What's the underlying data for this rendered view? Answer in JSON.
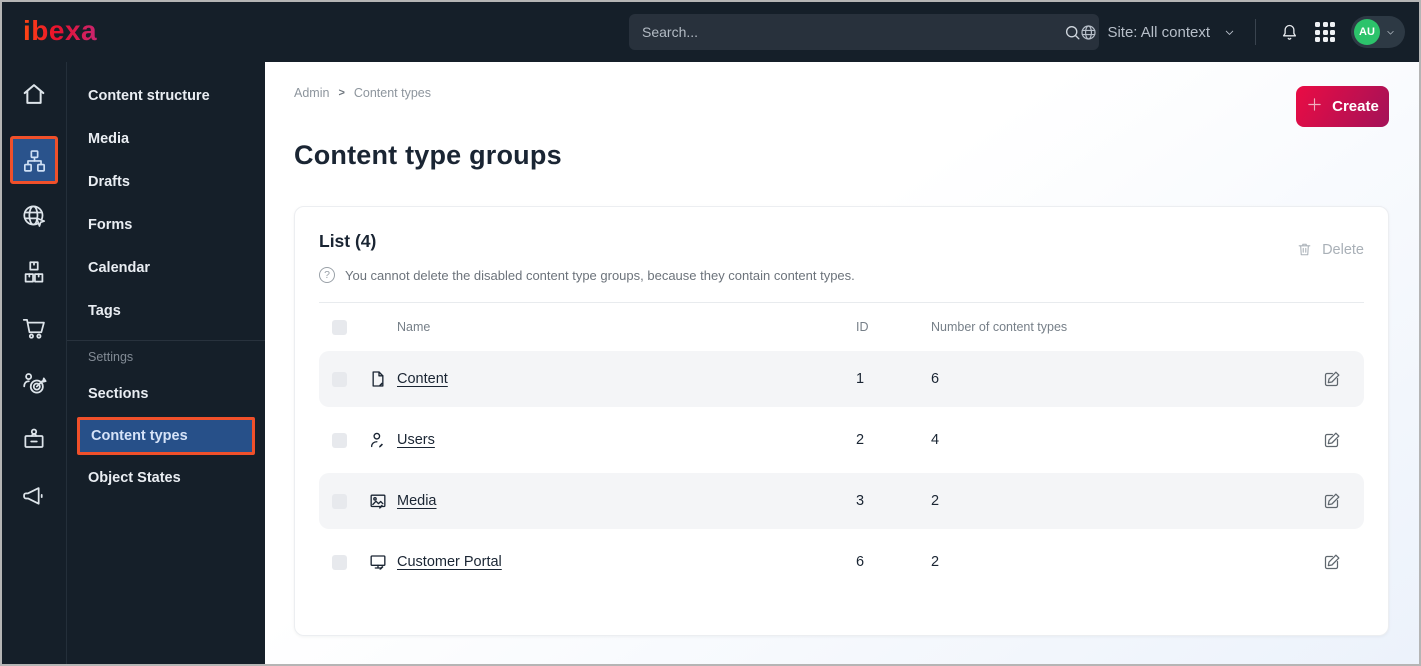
{
  "topbar": {
    "logo_text": "ibexa",
    "search": {
      "placeholder": "Search..."
    },
    "site_context_label": "Site: All context",
    "avatar_initials": "AU",
    "icons": [
      "search-icon",
      "globe-icon",
      "chevron-down-icon",
      "bell-icon",
      "app-grid-icon"
    ]
  },
  "nav_rail": {
    "icons": [
      "home-icon",
      "content-structure-icon",
      "site-globe-icon",
      "product-catalog-icon",
      "commerce-cart-icon",
      "personalization-icon",
      "admin-badge-icon",
      "campaign-megaphone-icon"
    ],
    "active_icon": "content-structure-icon"
  },
  "sidebar": {
    "items": [
      "Content structure",
      "Media",
      "Drafts",
      "Forms",
      "Calendar",
      "Tags"
    ],
    "settings_label": "Settings",
    "settings_items": [
      "Sections",
      "Content types",
      "Object States"
    ],
    "active_item": "Content types"
  },
  "breadcrumb": {
    "items": [
      "Admin",
      "Content types"
    ],
    "separator": ">"
  },
  "page": {
    "title": "Content type groups"
  },
  "actions": {
    "create_label": "Create",
    "delete_label": "Delete"
  },
  "list_card": {
    "title": "List (4)",
    "info_text": "You cannot delete the disabled content type groups, because they contain content types.",
    "headers": {
      "name": "Name",
      "id": "ID",
      "count": "Number of content types"
    },
    "rows": [
      {
        "name": "Content",
        "icon": "file-edit-icon",
        "id": "1",
        "count": "6"
      },
      {
        "name": "Users",
        "icon": "user-edit-icon",
        "id": "2",
        "count": "4"
      },
      {
        "name": "Media",
        "icon": "image-edit-icon",
        "id": "3",
        "count": "2"
      },
      {
        "name": "Customer Portal",
        "icon": "monitor-edit-icon",
        "id": "6",
        "count": "2"
      }
    ]
  },
  "colors": {
    "topbar_bg": "#151f29",
    "accent_orange": "#f0502a",
    "selected_blue": "#2a538c",
    "create_gradient": [
      "#ea0c44",
      "#a31258"
    ],
    "avatar_green": "#2cc36b",
    "zebra_row": "#f4f5f7"
  }
}
